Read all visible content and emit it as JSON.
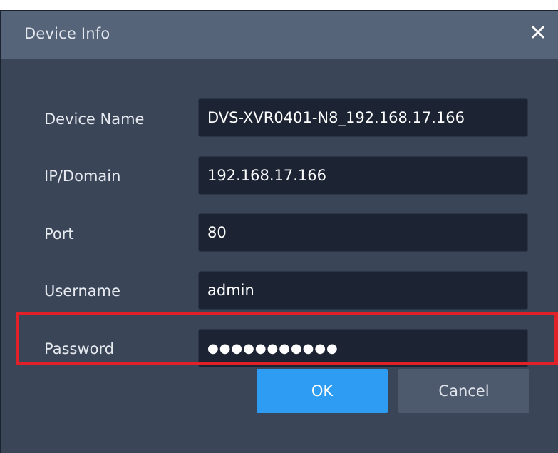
{
  "dialog": {
    "title": "Device Info",
    "close_icon": "close-icon"
  },
  "form": {
    "device_name": {
      "label": "Device Name",
      "value": "DVS-XVR0401-N8_192.168.17.166"
    },
    "ip_domain": {
      "label": "IP/Domain",
      "value": "192.168.17.166"
    },
    "port": {
      "label": "Port",
      "value": "80"
    },
    "username": {
      "label": "Username",
      "value": "admin"
    },
    "password": {
      "label": "Password",
      "value": "●●●●●●●●●●●"
    }
  },
  "buttons": {
    "ok_label": "OK",
    "cancel_label": "Cancel"
  },
  "colors": {
    "titlebar": "#56647a",
    "body": "#3a4558",
    "field": "#1c2434",
    "ok_button": "#2e9cf2",
    "cancel_button": "#4d596d",
    "highlight": "#e02128"
  }
}
